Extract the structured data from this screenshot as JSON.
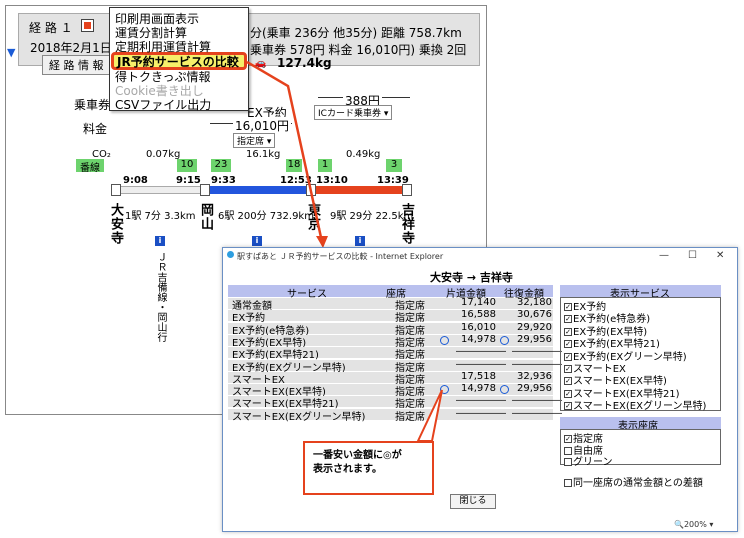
{
  "route": {
    "route_label": "経 路 １",
    "date": "2018年2月1日",
    "summary_line1": "分(乗車 236分 他35分) 距離 758.7km",
    "summary_line2": "乗車券 578円 料金 16,010円) 乗換 2回",
    "info_button": "経 路 情 報",
    "co2_total": "127.4kg",
    "fare_label": "乗車券",
    "charge_label": "料金",
    "fare_ic_amount": "388円",
    "fare_ic_dropdown": "ICカード乗車券",
    "ex_reserve": "EX予約",
    "charge_amount": "16,010円",
    "seat_dropdown": "指定席",
    "co2_label": "CO₂",
    "track_label": "番線",
    "co2_values": [
      "0.07kg",
      "16.1kg",
      "0.49kg"
    ],
    "tracks": [
      "10",
      "23",
      "18",
      "1",
      "3"
    ],
    "times": [
      "9:08",
      "9:15",
      "9:33",
      "12:53",
      "13:10",
      "13:39"
    ],
    "segment_info": [
      "1駅 7分 3.3km",
      "6駅 200分 732.9km",
      "9駅 29分 22.5km"
    ],
    "stations": [
      "大安寺",
      "岡山",
      "東京",
      "吉祥寺"
    ],
    "line_name": "ＪＲ吉備線・岡山行"
  },
  "menu": {
    "items": [
      {
        "label": "印刷用画面表示",
        "enabled": true
      },
      {
        "label": "運賃分割計算",
        "enabled": true
      },
      {
        "label": "定期利用運賃計算",
        "enabled": true
      },
      {
        "label": "JR予約サービスの比較",
        "enabled": true,
        "highlighted": true
      },
      {
        "label": "得トクきっぷ情報",
        "enabled": true
      },
      {
        "label": "Cookie書き出し",
        "enabled": false
      },
      {
        "label": "CSVファイル出力",
        "enabled": true
      }
    ]
  },
  "dialog": {
    "title": "駅すぱあと ＪＲ予約サービスの比較 - Internet Explorer",
    "route": "大安寺 → 吉祥寺",
    "headers": [
      "サービス",
      "座席",
      "片道金額",
      "往復金額"
    ],
    "rows": [
      {
        "service": "通常金額",
        "seat": "指定席",
        "oneway": "17,140",
        "round": "32,180",
        "best": false
      },
      {
        "service": "EX予約",
        "seat": "指定席",
        "oneway": "16,588",
        "round": "30,676",
        "best": false
      },
      {
        "service": "EX予約(e特急券)",
        "seat": "指定席",
        "oneway": "16,010",
        "round": "29,920",
        "best": false
      },
      {
        "service": "EX予約(EX早特)",
        "seat": "指定席",
        "oneway": "14,978",
        "round": "29,956",
        "best": true
      },
      {
        "service": "EX予約(EX早特21)",
        "seat": "指定席",
        "oneway": "―――――",
        "round": "―――――",
        "best": false
      },
      {
        "service": "EX予約(EXグリーン早特)",
        "seat": "指定席",
        "oneway": "―――――",
        "round": "―――――",
        "best": false
      },
      {
        "service": "スマートEX",
        "seat": "指定席",
        "oneway": "17,518",
        "round": "32,936",
        "best": false
      },
      {
        "service": "スマートEX(EX早特)",
        "seat": "指定席",
        "oneway": "14,978",
        "round": "29,956",
        "best": true
      },
      {
        "service": "スマートEX(EX早特21)",
        "seat": "指定席",
        "oneway": "―――――",
        "round": "―――――",
        "best": false
      },
      {
        "service": "スマートEX(EXグリーン早特)",
        "seat": "指定席",
        "oneway": "―――――",
        "round": "―――――",
        "best": false
      }
    ],
    "display_service_header": "表示サービス",
    "display_services": [
      "EX予約",
      "EX予約(e特急券)",
      "EX予約(EX早特)",
      "EX予約(EX早特21)",
      "EX予約(EXグリーン早特)",
      "スマートEX",
      "スマートEX(EX早特)",
      "スマートEX(EX早特21)",
      "スマートEX(EXグリーン早特)"
    ],
    "display_seat_header": "表示座席",
    "seat_options": [
      {
        "label": "指定席",
        "checked": true
      },
      {
        "label": "自由席",
        "checked": false
      },
      {
        "label": "グリーン",
        "checked": false
      }
    ],
    "same_seat_label": "同一座席の通常金額との差額",
    "close_button": "閉じる",
    "zoom": "200%"
  },
  "callout": {
    "line1": "一番安い金額に◎が",
    "line2": "表示されます。"
  },
  "colors": {
    "accent": "#e5421d",
    "header": "#b9c0ee",
    "highlight": "#f6ef6a",
    "track": "#6dd36d",
    "segment_blue": "#2255dd",
    "segment_red": "#e5421d"
  }
}
